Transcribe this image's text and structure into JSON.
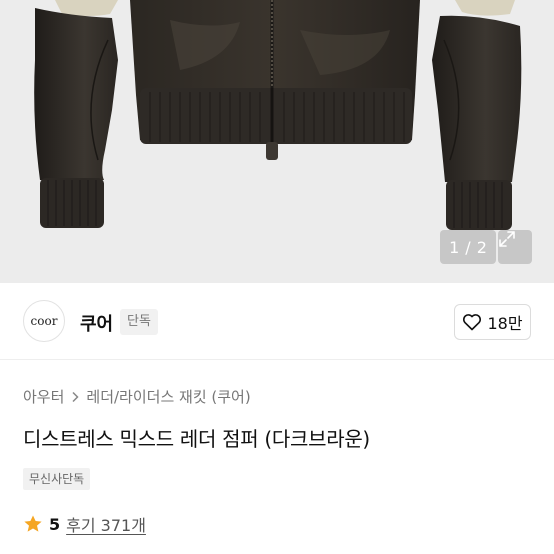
{
  "gallery": {
    "current_page": "1",
    "separator": "/",
    "total_pages": "2",
    "expand_icon": "expand-arrows-icon"
  },
  "brand": {
    "logo_text": "coor",
    "name": "쿠어",
    "badge": "단독"
  },
  "like": {
    "icon": "heart-outline-icon",
    "count": "18만"
  },
  "breadcrumb": {
    "items": [
      "아우터",
      "레더/라이더스 재킷 (쿠어)"
    ],
    "separator_icon": "chevron-right-icon"
  },
  "product": {
    "title": "디스트레스 믹스드 레더 점퍼 (다크브라운)",
    "exclusive_badge": "무신사단독"
  },
  "rating": {
    "icon": "star-icon",
    "score": "5",
    "review_text": "후기 371개",
    "star_color": "#f5a623"
  }
}
